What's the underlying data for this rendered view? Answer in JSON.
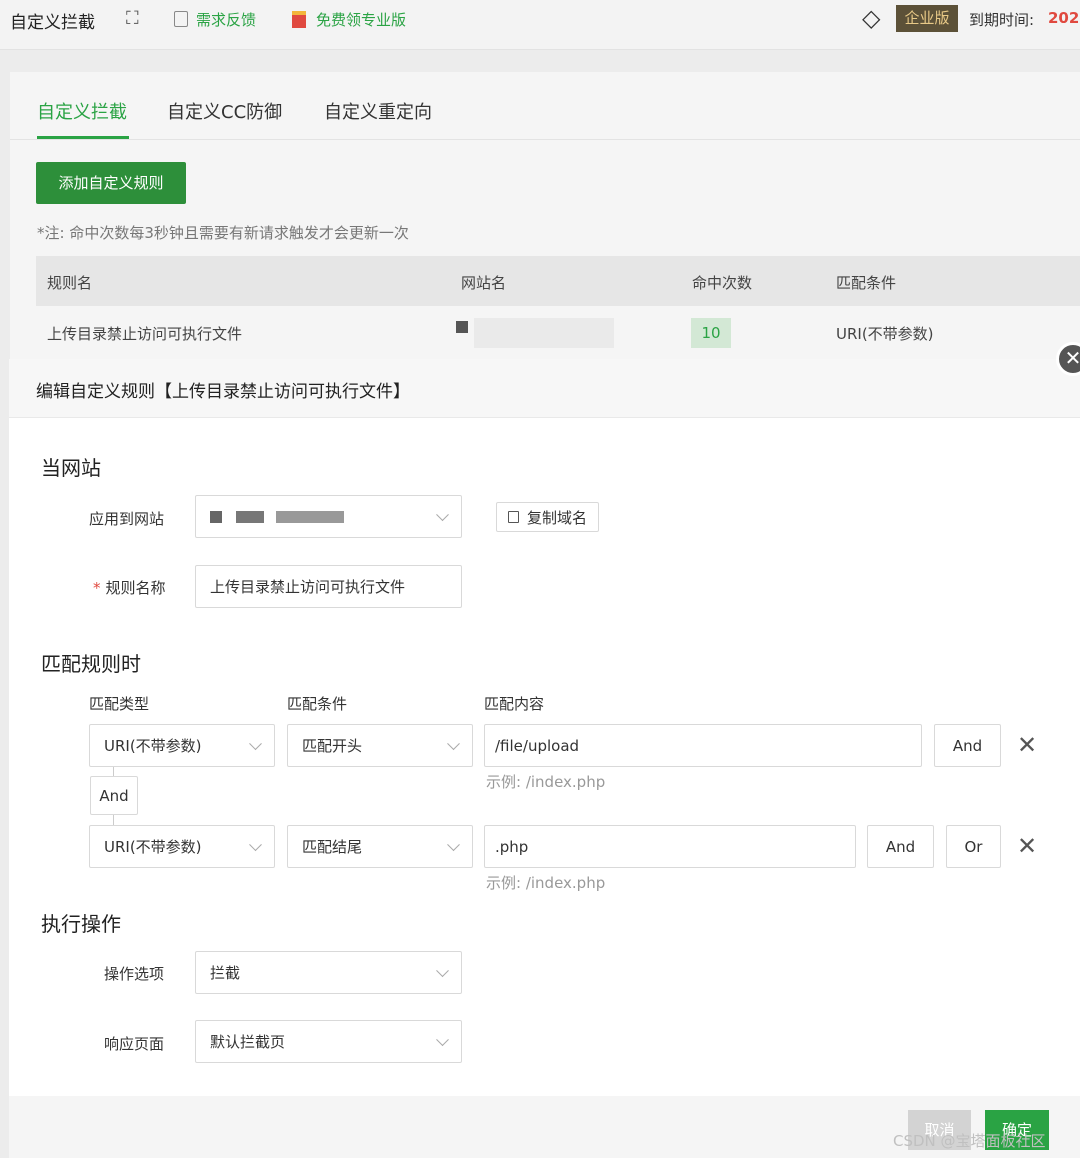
{
  "header": {
    "title": "自定义拦截",
    "feedback_label": "需求反馈",
    "free_pro_label": "免费领专业版",
    "edition_badge": "企业版",
    "expire_label": "到期时间:",
    "expire_value": "202"
  },
  "tabs": [
    "自定义拦截",
    "自定义CC防御",
    "自定义重定向"
  ],
  "add_rule_button": "添加自定义规则",
  "note": "*注: 命中次数每3秒钟且需要有新请求触发才会更新一次",
  "table": {
    "columns": [
      "规则名",
      "网站名",
      "命中次数",
      "匹配条件"
    ],
    "rows": [
      {
        "name": "上传目录禁止访问可执行文件",
        "hits": "10",
        "condition": "URI(不带参数)"
      }
    ]
  },
  "modal": {
    "title": "编辑自定义规则【上传目录禁止访问可执行文件】",
    "section_site": "当网站",
    "apply_site_label": "应用到网站",
    "copy_domain_button": "复制域名",
    "rule_name_label": "规则名称",
    "rule_name_value": "上传目录禁止访问可执行文件",
    "section_match": "匹配规则时",
    "col_type": "匹配类型",
    "col_cond": "匹配条件",
    "col_content": "匹配内容",
    "rules": [
      {
        "type": "URI(不带参数)",
        "cond": "匹配开头",
        "content": "/file/upload",
        "hint": "示例: /index.php"
      },
      {
        "type": "URI(不带参数)",
        "cond": "匹配结尾",
        "content": ".php",
        "hint": "示例: /index.php"
      }
    ],
    "and_label": "And",
    "or_label": "Or",
    "section_action": "执行操作",
    "action_label": "操作选项",
    "action_value": "拦截",
    "response_label": "响应页面",
    "response_value": "默认拦截页",
    "cancel_button": "取消",
    "ok_button": "确定"
  },
  "watermark": "CSDN @宝塔面板社区",
  "colors": {
    "accent": "#2aa344",
    "danger": "#e0493f",
    "badge_bg": "#5c5138",
    "badge_text": "#e8c987"
  }
}
